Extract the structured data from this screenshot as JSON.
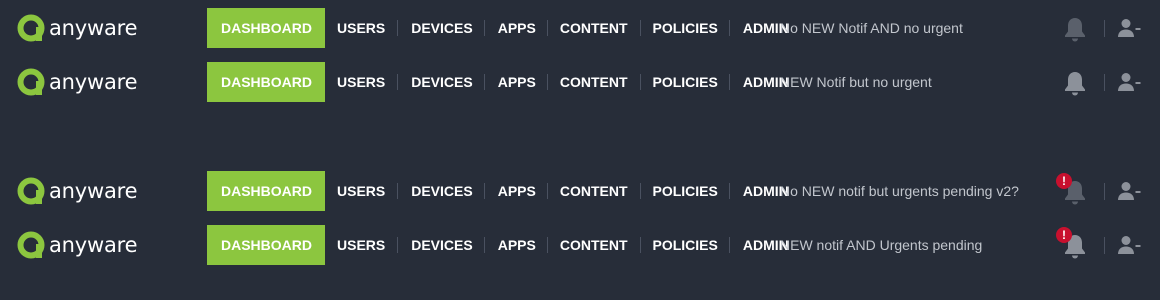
{
  "brand": {
    "name": "anyware",
    "accent": "#8cc63f"
  },
  "menu": {
    "items": [
      "DASHBOARD",
      "USERS",
      "DEVICES",
      "APPS",
      "CONTENT",
      "POLICIES",
      "ADMIN"
    ],
    "active": "DASHBOARD"
  },
  "variants": [
    {
      "status_text": "No NEW Notif AND no urgent",
      "bell_state": "dim",
      "urgent_badge": ""
    },
    {
      "status_text": "NEW Notif but no urgent",
      "bell_state": "bright",
      "urgent_badge": ""
    },
    {
      "status_text": "No NEW notif but urgents pending v2?",
      "bell_state": "dim",
      "urgent_badge": "!"
    },
    {
      "status_text": "NEW notif AND Urgents pending",
      "bell_state": "bright",
      "urgent_badge": "!"
    }
  ],
  "icons": {
    "bell": "bell-icon",
    "user": "user-menu-icon",
    "urgent": "exclamation-icon"
  },
  "colors": {
    "background": "#272d39",
    "urgent": "#c8102e",
    "status_text": "#c2c6cd"
  }
}
